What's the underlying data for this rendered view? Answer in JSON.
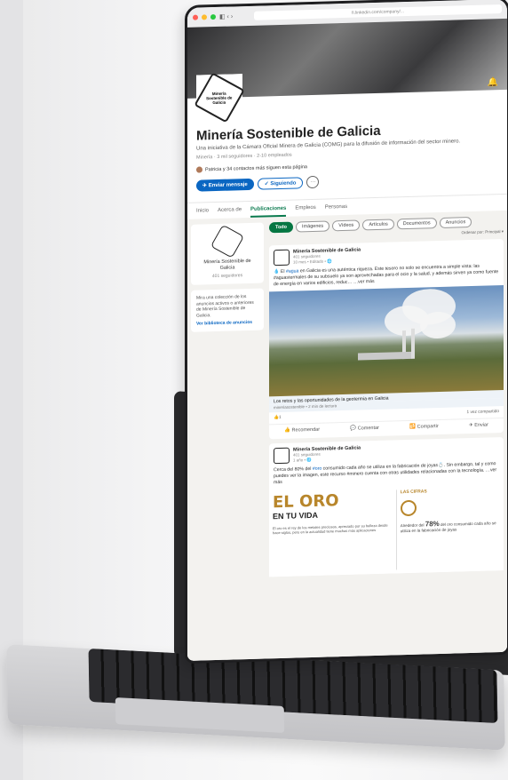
{
  "browser": {
    "url": "fi.linkedin.com/company/...",
    "nav": "◧ ‹ ›"
  },
  "company": {
    "logo_text": "Minería Sostenible de Galicia",
    "name": "Minería Sostenible de Galicia",
    "tagline": "Una iniciativa de la Cámara Oficial Minera de Galicia (COMG) para la difusión de información del sector minero.",
    "meta": "Minería · 3 mil seguidores · 2-10 empleados",
    "mutual": "Patricia y 34 contactos más siguen esta página",
    "send_message": "✈ Enviar mensaje",
    "following": "✓ Siguiendo",
    "more": "···"
  },
  "tabs": [
    "Inicio",
    "Acerca de",
    "Publicaciones",
    "Empleos",
    "Personas"
  ],
  "sidebar": {
    "title": "Minería Sostenible de Galicia",
    "followers": "401 seguidores",
    "ad_text": "Mira una colección de los anuncios activos o anteriores de Minería Sostenible de Galicia.",
    "ad_link": "Ver biblioteca de anuncios"
  },
  "filters": [
    "Todo",
    "Imágenes",
    "Vídeos",
    "Artículos",
    "Documentos",
    "Anuncios"
  ],
  "sort": "Ordenar por: Principal ▾",
  "posts": [
    {
      "author": "Minería Sostenible de Galicia",
      "meta1": "401 seguidores",
      "meta2": "10 mes • Editado • 🌐",
      "text_pre": "💧 El ",
      "text_hl": "#agua",
      "text_post": " en Galicia es una auténtica riqueza. Este tesoro no solo se encuentra a simple vista: las #aguastermales de su subsuelo ya son aprovechadas para el ocio y la salud, y además sirven ya como fuente de energía en varios edificios, reduc… …ver más",
      "caption": "Los retos y las oportunidades de la geotermia en Galicia",
      "caption_meta": "mineriasostenible • 2 min de lectura",
      "reactions": "👍1",
      "shares": "1 vez compartido",
      "actions": [
        "👍 Recomendar",
        "💬 Comentar",
        "🔁 Compartir",
        "✈ Enviar"
      ]
    },
    {
      "author": "Minería Sostenible de Galicia",
      "meta1": "401 seguidores",
      "meta2": "1 año • 🌐",
      "text_pre": "Cerca del 80% del ",
      "text_hl": "#oro",
      "text_post": " consumido cada año se utiliza en la fabricación de joyas💍. Sin embargo, tal y como puedes ver la imagen, este recurso #minero cuenta con otras utilidades relacionadas con la tecnología. …ver más",
      "oro_title": "EL ORO",
      "oro_sub": "EN TU VIDA",
      "oro_small": "El oro es el rey de los metales preciosos, apreciado por su belleza desde hace siglos, pero en la actualidad tiene muchas más aplicaciones",
      "cifras": "LAS CIFRAS",
      "pct_pre": "Alrededor del ",
      "pct_value": "78%",
      "pct_post": " del oro consumido cada año se utiliza en la fabricación de joyas"
    }
  ]
}
